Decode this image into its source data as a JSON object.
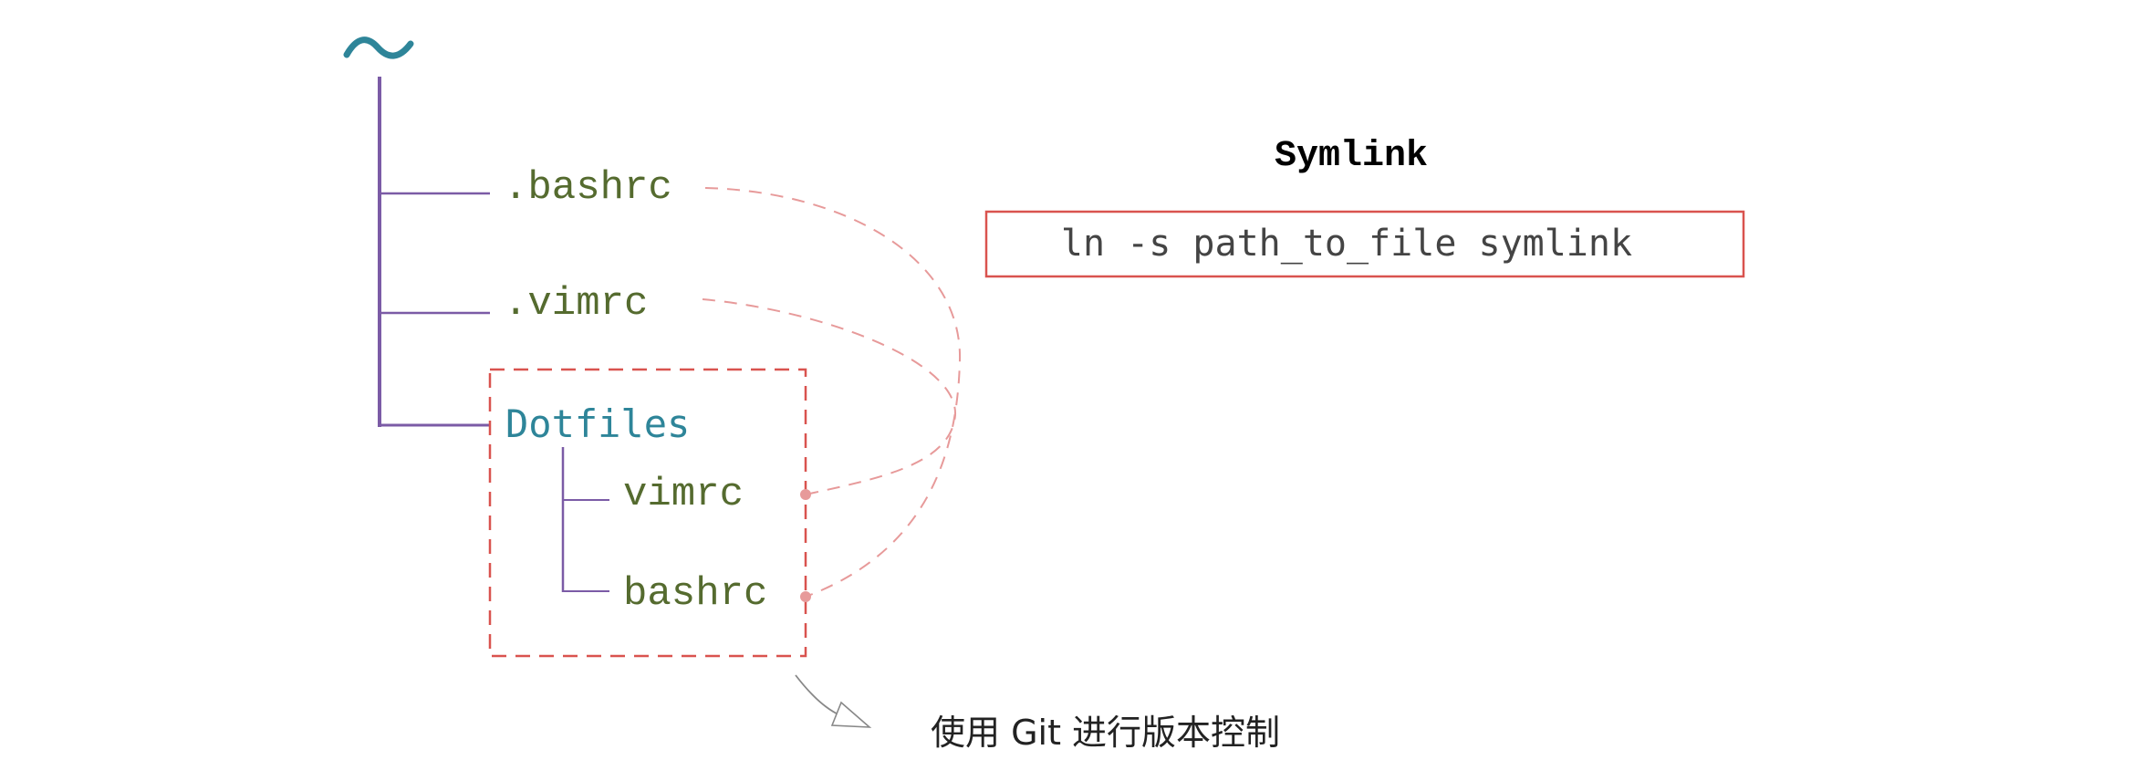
{
  "root": {
    "label": "~",
    "color": "#2e8599"
  },
  "tree": {
    "items": [
      {
        "label": ".bashrc",
        "color": "#556b2f"
      },
      {
        "label": ".vimrc",
        "color": "#556b2f"
      }
    ],
    "folder": {
      "label": "Dotfiles",
      "color": "#2e8599",
      "children": [
        {
          "label": "vimrc",
          "color": "#556b2f"
        },
        {
          "label": "bashrc",
          "color": "#556b2f"
        }
      ]
    },
    "line_color": "#7b5ba6"
  },
  "symlink": {
    "title": "Symlink",
    "command": "ln -s path_to_file symlink",
    "box_color": "#d9534f"
  },
  "note": {
    "text": "使用 Git 进行版本控制"
  },
  "link_color": "#e79a9a",
  "box_color": "#d9534f"
}
